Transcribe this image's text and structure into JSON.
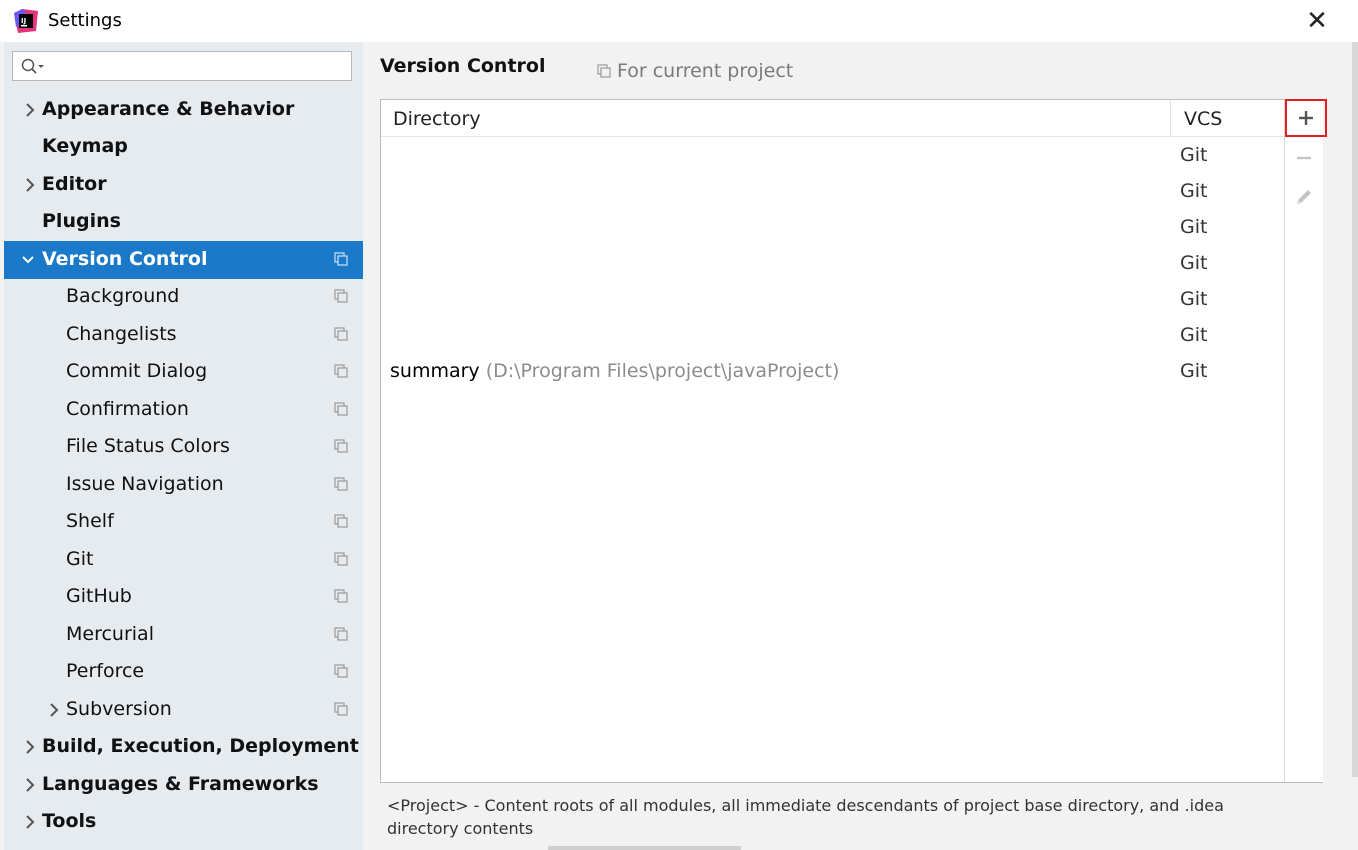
{
  "window": {
    "title": "Settings",
    "close_label": "✕"
  },
  "search": {
    "placeholder": ""
  },
  "sidebar": {
    "items": [
      {
        "label": "Appearance & Behavior"
      },
      {
        "label": "Keymap"
      },
      {
        "label": "Editor"
      },
      {
        "label": "Plugins"
      },
      {
        "label": "Version Control"
      },
      {
        "label": "Background"
      },
      {
        "label": "Changelists"
      },
      {
        "label": "Commit Dialog"
      },
      {
        "label": "Confirmation"
      },
      {
        "label": "File Status Colors"
      },
      {
        "label": "Issue Navigation"
      },
      {
        "label": "Shelf"
      },
      {
        "label": "Git"
      },
      {
        "label": "GitHub"
      },
      {
        "label": "Mercurial"
      },
      {
        "label": "Perforce"
      },
      {
        "label": "Subversion"
      },
      {
        "label": "Build, Execution, Deployment"
      },
      {
        "label": "Languages & Frameworks"
      },
      {
        "label": "Tools"
      }
    ]
  },
  "main": {
    "heading": "Version Control",
    "scope_label": "For current project",
    "table": {
      "headers": {
        "directory": "Directory",
        "vcs": "VCS"
      },
      "rows": [
        {
          "name": "",
          "path": "",
          "vcs": "Git"
        },
        {
          "name": "",
          "path": "",
          "vcs": "Git"
        },
        {
          "name": "",
          "path": "",
          "vcs": "Git"
        },
        {
          "name": "",
          "path": "",
          "vcs": "Git"
        },
        {
          "name": "",
          "path": "",
          "vcs": "Git"
        },
        {
          "name": "",
          "path": "",
          "vcs": "Git"
        },
        {
          "name": "summary",
          "path": "(D:\\Program Files\\project\\javaProject)",
          "vcs": "Git"
        }
      ]
    },
    "toolbar": {
      "add": "+",
      "remove": "−"
    },
    "footer": "<Project> - Content roots of all modules, all immediate descendants of project base directory, and .idea directory contents"
  },
  "colors": {
    "selection": "#1a79c8",
    "sidebar_bg": "#e6ebf0",
    "highlight_border": "#e02020"
  }
}
